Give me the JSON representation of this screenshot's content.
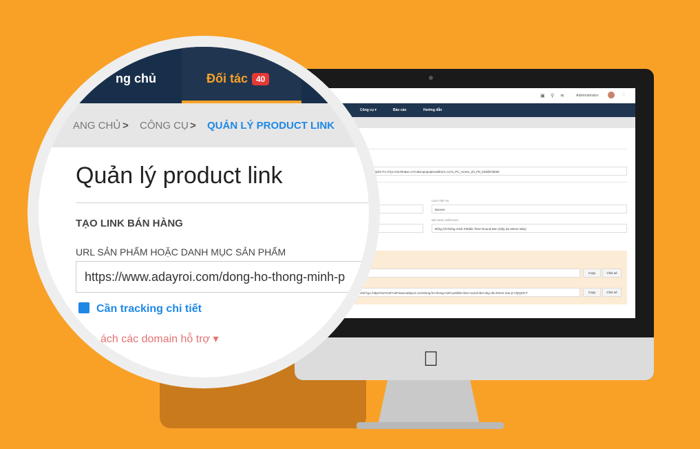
{
  "screen": {
    "topbar": {
      "admin": "Administrator"
    },
    "nav": [
      {
        "label": "Công cụ ▾"
      },
      {
        "label": "Báo cáo"
      },
      {
        "label": "Hướng dẫn"
      }
    ],
    "url_field": "m-nau-p-VQQZS-F1-2?pi=GOJ0n&w=oYnJ&nopopuptrue&from=13-6_PC_Home_Z3_P8_MobileTablet",
    "cach_tiep_thi_label": "CÁCH TIẾP THỊ",
    "cach_tiep_thi_value": "Banner",
    "noi_dung_label": "NỘI DUNG CHIẾN DỊCH",
    "noi_dung_value": "Đồng hồ thông minh Pebble Time Round Đen (Dây da 20mm Nâu)",
    "link2": "mmk/?go=https%3A%2F%2Fwww.adayroi.com/dong-ho-thong-minh-pebble-time-round-den-day-da-20mm-nau-p-VQQZS-F",
    "copy_label": "Copy",
    "share_label": "Chia sẻ"
  },
  "lens": {
    "nav_home": "ng chủ",
    "nav_partner": "Đối tác",
    "badge": "40",
    "crumb_home": "ANG CHỦ",
    "crumb_sep": ">",
    "crumb_tools": "CÔNG CỤ",
    "crumb_current": "QUẢN LÝ PRODUCT LINK",
    "title": "Quản lý product link",
    "section": "TẠO LINK BÁN HÀNG",
    "url_label": "URL SẢN PHẨM HOẶC DANH MỤC SẢN PHẨM",
    "url_value": "https://www.adayroi.com/dong-ho-thong-minh-p",
    "tracking_label": "Cần tracking chi tiết",
    "domain_link": "ách các domain hỗ trợ ▾"
  }
}
